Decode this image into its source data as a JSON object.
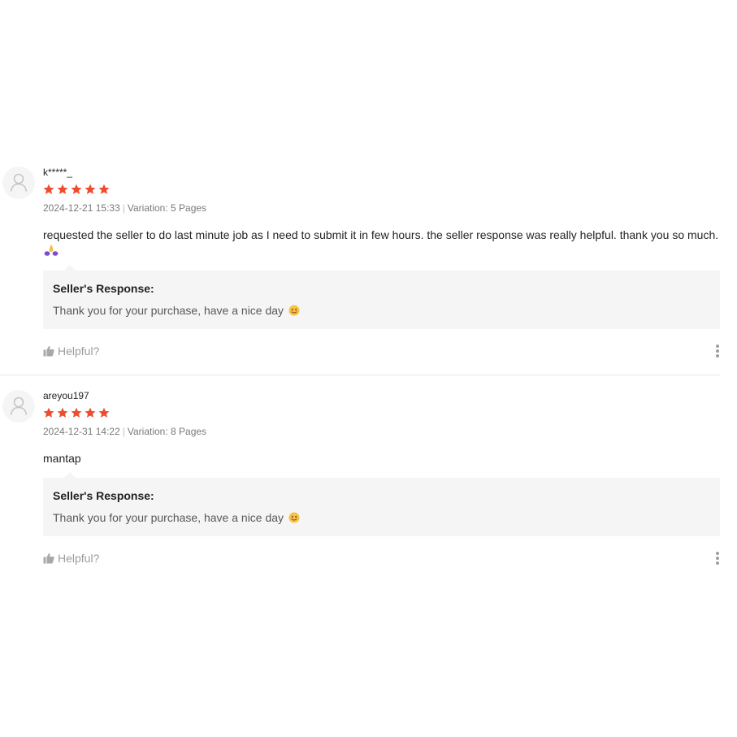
{
  "colors": {
    "star": "#ee4d2d",
    "response_bg": "#f5f5f5",
    "muted_text": "#8a8a8a"
  },
  "reviews": [
    {
      "username": "k*****_",
      "rating": 5,
      "date": "2024-12-21 15:33",
      "variation": "Variation: 5 Pages",
      "comment": "requested the seller to do last minute job as I need to submit it in few hours. the seller response was really helpful. thank you so much.",
      "comment_emoji": "praying-hands-icon",
      "seller_response": {
        "title": "Seller's Response:",
        "text": "Thank you for your purchase, have a nice day"
      },
      "helpful_label": "Helpful?"
    },
    {
      "username": "areyou197",
      "rating": 5,
      "date": "2024-12-31 14:22",
      "variation": "Variation: 8 Pages",
      "comment": "mantap",
      "seller_response": {
        "title": "Seller's Response:",
        "text": "Thank you for your purchase, have a nice day"
      },
      "helpful_label": "Helpful?"
    }
  ]
}
